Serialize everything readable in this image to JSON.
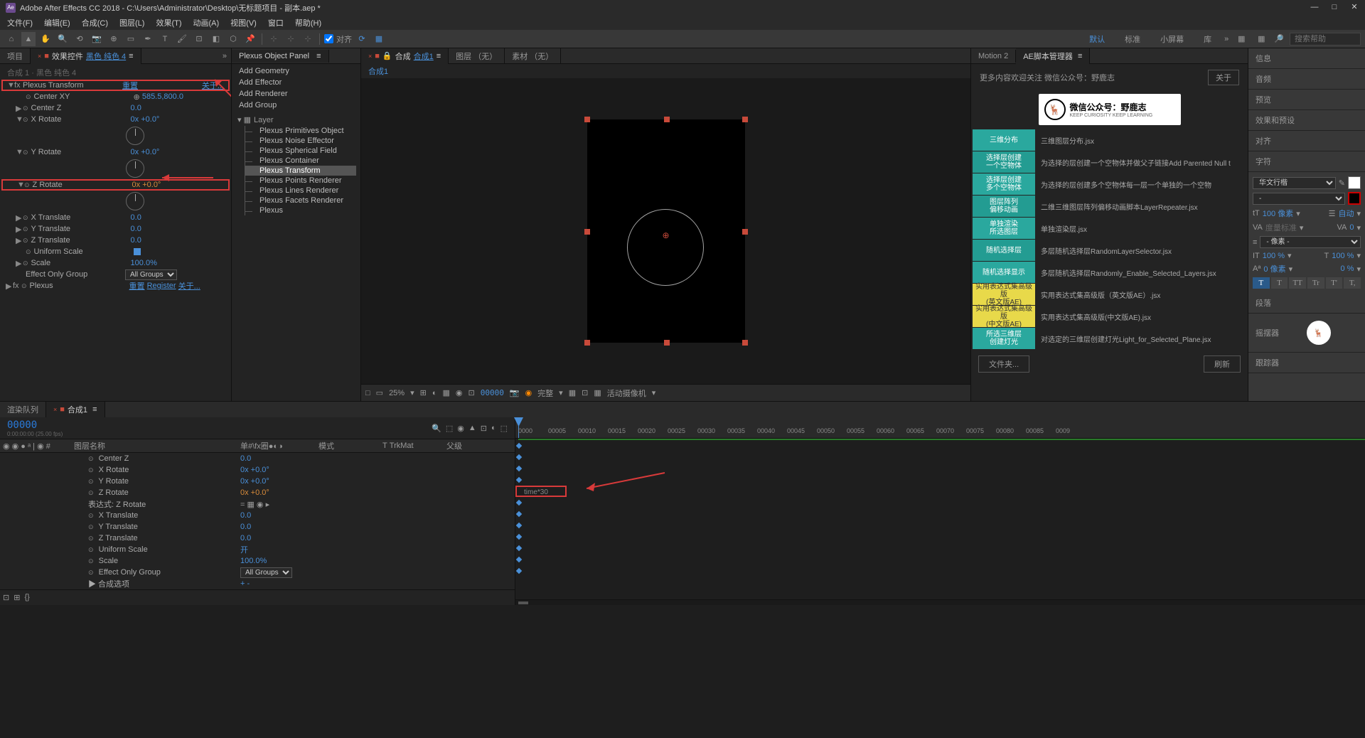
{
  "titlebar": {
    "app_icon": "Ae",
    "title": "Adobe After Effects CC 2018 - C:\\Users\\Administrator\\Desktop\\无标题项目 - 副本.aep *"
  },
  "menubar": [
    "文件(F)",
    "编辑(E)",
    "合成(C)",
    "图层(L)",
    "效果(T)",
    "动画(A)",
    "视图(V)",
    "窗口",
    "帮助(H)"
  ],
  "toolbar": {
    "snap_label": "对齐",
    "workspaces": [
      "默认",
      "标准",
      "小屏幕",
      "库"
    ],
    "active_workspace": 0,
    "search_placeholder": "搜索帮助"
  },
  "left_panel": {
    "tabs": {
      "project": "项目",
      "effects": "效果控件",
      "effects_target": "黑色 纯色 4"
    },
    "header_sub": "合成 1 · 黑色 纯色 4",
    "plexus_transform": {
      "name": "Plexus Transform",
      "reset": "重置",
      "about": "关于..."
    },
    "props": {
      "center_xy": {
        "name": "Center XY",
        "val": "585.5,800.0"
      },
      "center_z": {
        "name": "Center Z",
        "val": "0.0"
      },
      "x_rotate": {
        "name": "X Rotate",
        "val": "0x +0.0°"
      },
      "y_rotate": {
        "name": "Y Rotate",
        "val": "0x +0.0°"
      },
      "z_rotate": {
        "name": "Z Rotate",
        "val": "0x +0.0°"
      },
      "x_translate": {
        "name": "X Translate",
        "val": "0.0"
      },
      "y_translate": {
        "name": "Y Translate",
        "val": "0.0"
      },
      "z_translate": {
        "name": "Z Translate",
        "val": "0.0"
      },
      "uniform_scale": {
        "name": "Uniform Scale"
      },
      "scale": {
        "name": "Scale",
        "val": "100.0%"
      },
      "effect_only_group": {
        "name": "Effect Only Group",
        "val": "All Groups"
      },
      "plexus": {
        "name": "Plexus",
        "reset": "重置",
        "register": "Register",
        "about": "关于..."
      }
    }
  },
  "plexus_panel": {
    "title": "Plexus Object Panel",
    "actions": [
      "Add Geometry",
      "Add Effector",
      "Add Renderer",
      "Add Group"
    ],
    "layer_label": "Layer",
    "tree": [
      "Plexus Primitives Object",
      "Plexus Noise Effector",
      "Plexus Spherical Field",
      "Plexus Container",
      "Plexus Transform",
      "Plexus Points Renderer",
      "Plexus Lines Renderer",
      "Plexus Facets Renderer",
      "Plexus"
    ],
    "selected": 4
  },
  "comp_panel": {
    "tabs": {
      "comp_prefix": "合成",
      "comp_name": "合成1",
      "layer": "图层 （无）",
      "footage": "素材 （无）"
    },
    "subtitle": "合成1",
    "footer": {
      "zoom": "25%",
      "time": "00000",
      "res": "完整",
      "camera": "活动摄像机"
    }
  },
  "script_panel": {
    "tabs": [
      "Motion 2",
      "AE脚本管理器"
    ],
    "welcome": "更多内容欢迎关注 微信公众号：野鹿志",
    "about": "关于",
    "wechat": {
      "title": "微信公众号：野鹿志",
      "sub": "KEEP CURIOSITY KEEP LEARNING"
    },
    "items": [
      {
        "btn": "三维分布",
        "cls": "teal",
        "desc": "三维图层分布.jsx"
      },
      {
        "btn": "选择层创建\n一个空物体",
        "cls": "teal2",
        "desc": "为选择的层创建一个空物体并做父子链接Add Parented Null t"
      },
      {
        "btn": "选择层创建\n多个空物体",
        "cls": "teal",
        "desc": "为选择的层创建多个空物体每一层一个单独的一个空物"
      },
      {
        "btn": "图层阵列\n偏移动画",
        "cls": "teal2",
        "desc": "二维三维图层阵列偏移动画脚本LayerRepeater.jsx"
      },
      {
        "btn": "单独渲染\n所选图层",
        "cls": "teal",
        "desc": "单独渲染层.jsx"
      },
      {
        "btn": "随机选择层",
        "cls": "teal2",
        "desc": "多层随机选择层RandomLayerSelector.jsx"
      },
      {
        "btn": "随机选择显示",
        "cls": "teal",
        "desc": "多层随机选择层Randomly_Enable_Selected_Layers.jsx"
      },
      {
        "btn": "实用表达式集高级版\n(英文版AE)",
        "cls": "yellow",
        "desc": "实用表达式集高级版（英文版AE）.jsx"
      },
      {
        "btn": "实用表达式集高级版\n(中文版AE)",
        "cls": "yellow",
        "desc": "实用表达式集高级版(中文版AE).jsx"
      },
      {
        "btn": "所选三维层\n创建灯光",
        "cls": "teal",
        "desc": "对选定的三维层创建灯光Light_for_Selected_Plane.jsx"
      }
    ],
    "footer": {
      "folder": "文件夹...",
      "refresh": "刷新"
    }
  },
  "right_sidebar": {
    "tabs": [
      "信息",
      "音频",
      "预览",
      "效果和预设",
      "对齐",
      "字符"
    ],
    "char": {
      "font": "华文行楷",
      "style": "-",
      "size": "100 像素",
      "auto": "自动",
      "tracking": "0",
      "units": "- 像素 -",
      "scale1": "100 %",
      "scale2": "100 %",
      "baseline": "0 像素",
      "pct": "0 %",
      "styles": [
        "T",
        "T",
        "TT",
        "Tr",
        "T'",
        "T,"
      ]
    },
    "sections": [
      "段落",
      "摇摆器",
      "跟踪器"
    ]
  },
  "timeline": {
    "tabs": {
      "render": "渲染队列",
      "comp": "合成1"
    },
    "timecode": "00000",
    "timecode_sub": "0:00:00:00 (25.00 fps)",
    "cols": {
      "layer": "图层名称",
      "mode": "模式",
      "trkmat": "TrkMat",
      "parent": "父级",
      "switches": "单#\\fx圈●◐◑"
    },
    "ruler_ticks": [
      "0000",
      "00005",
      "00010",
      "00015",
      "00020",
      "00025",
      "00030",
      "00035",
      "00040",
      "00045",
      "00050",
      "00055",
      "00060",
      "00065",
      "00070",
      "00075",
      "00080",
      "00085",
      "0009"
    ],
    "props": [
      {
        "name": "Center Z",
        "val": "0.0",
        "cls": ""
      },
      {
        "name": "X Rotate",
        "val": "0x +0.0°",
        "cls": ""
      },
      {
        "name": "Y Rotate",
        "val": "0x +0.0°",
        "cls": ""
      },
      {
        "name": "Z Rotate",
        "val": "0x +0.0°",
        "cls": "orange"
      },
      {
        "name": "表达式: Z Rotate",
        "val": "",
        "cls": "",
        "expr_icons": "= ▦ ◉ ▸"
      },
      {
        "name": "X Translate",
        "val": "0.0",
        "cls": ""
      },
      {
        "name": "Y Translate",
        "val": "0.0",
        "cls": ""
      },
      {
        "name": "Z Translate",
        "val": "0.0",
        "cls": ""
      },
      {
        "name": "Uniform Scale",
        "val": "开",
        "cls": ""
      },
      {
        "name": "Scale",
        "val": "100.0%",
        "cls": ""
      },
      {
        "name": "Effect Only Group",
        "val": "All Groups",
        "cls": "",
        "dropdown": true
      },
      {
        "name": "合成选项",
        "val": "+ -",
        "cls": "",
        "toggle": true
      }
    ],
    "expression_text": "time*30"
  }
}
